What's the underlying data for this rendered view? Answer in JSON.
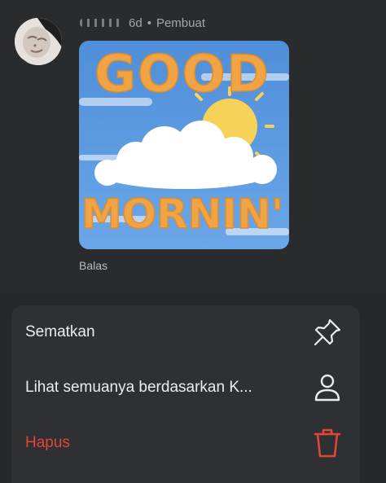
{
  "comment": {
    "author": "",
    "time": "6d",
    "separator": "•",
    "role": "Pembuat",
    "reply_label": "Balas",
    "sticker": {
      "top_text": "GOOD",
      "bottom_text": "MORNIN'",
      "colors": {
        "sky": "#5b9be0",
        "text": "#f0a446",
        "sun": "#f6d259",
        "cloud": "#ffffff"
      }
    }
  },
  "menu": {
    "items": [
      {
        "label": "Sematkan",
        "icon": "pin-icon"
      },
      {
        "label": "Lihat semuanya berdasarkan K...",
        "icon": "person-icon"
      },
      {
        "label": "Hapus",
        "icon": "trash-icon"
      }
    ],
    "colors": {
      "danger": "#e0463a",
      "text": "#ececec"
    }
  }
}
